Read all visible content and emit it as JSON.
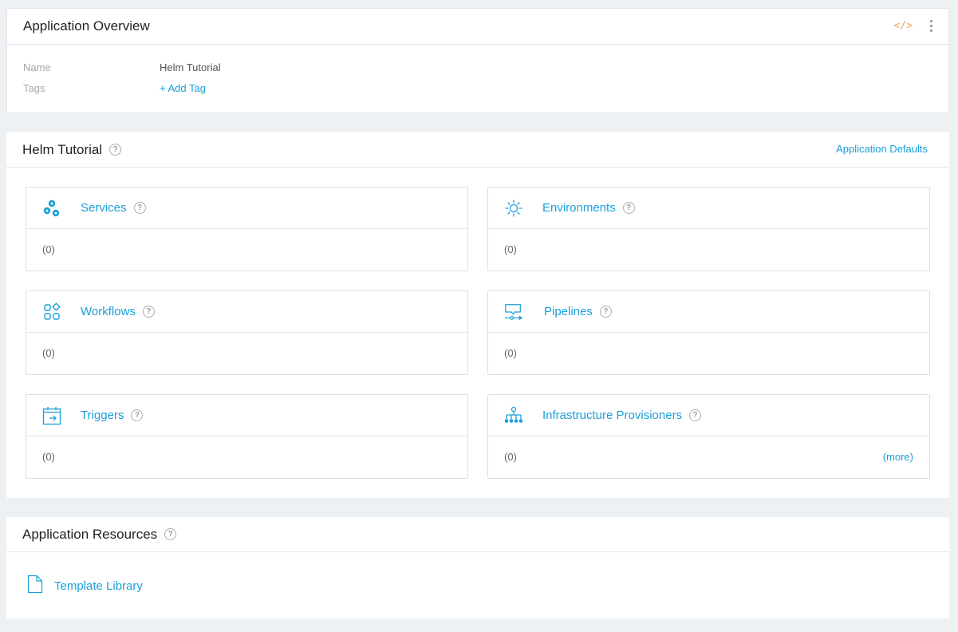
{
  "overview": {
    "title": "Application Overview",
    "code_icon": "</>",
    "fields": [
      {
        "label": "Name",
        "value": "Helm Tutorial"
      },
      {
        "label": "Tags",
        "value": "+ Add Tag"
      }
    ]
  },
  "app": {
    "title": "Helm Tutorial",
    "help": "?",
    "defaults_link": "Application Defaults",
    "tiles": [
      {
        "title": "Services",
        "icon": "services-icon",
        "count": "(0)"
      },
      {
        "title": "Environments",
        "icon": "environments-icon",
        "count": "(0)"
      },
      {
        "title": "Workflows",
        "icon": "workflows-icon",
        "count": "(0)"
      },
      {
        "title": "Pipelines",
        "icon": "pipelines-icon",
        "count": "(0)"
      },
      {
        "title": "Triggers",
        "icon": "triggers-icon",
        "count": "(0)"
      },
      {
        "title": "Infrastructure Provisioners",
        "icon": "provisioners-icon",
        "count": "(0)",
        "more": "(more)"
      }
    ]
  },
  "resources": {
    "title": "Application Resources",
    "items": [
      {
        "label": "Template Library",
        "icon": "file-icon"
      }
    ]
  },
  "colors": {
    "accent": "#1a9fd9",
    "code_icon": "#f6a15a",
    "background": "#eef1f4"
  }
}
